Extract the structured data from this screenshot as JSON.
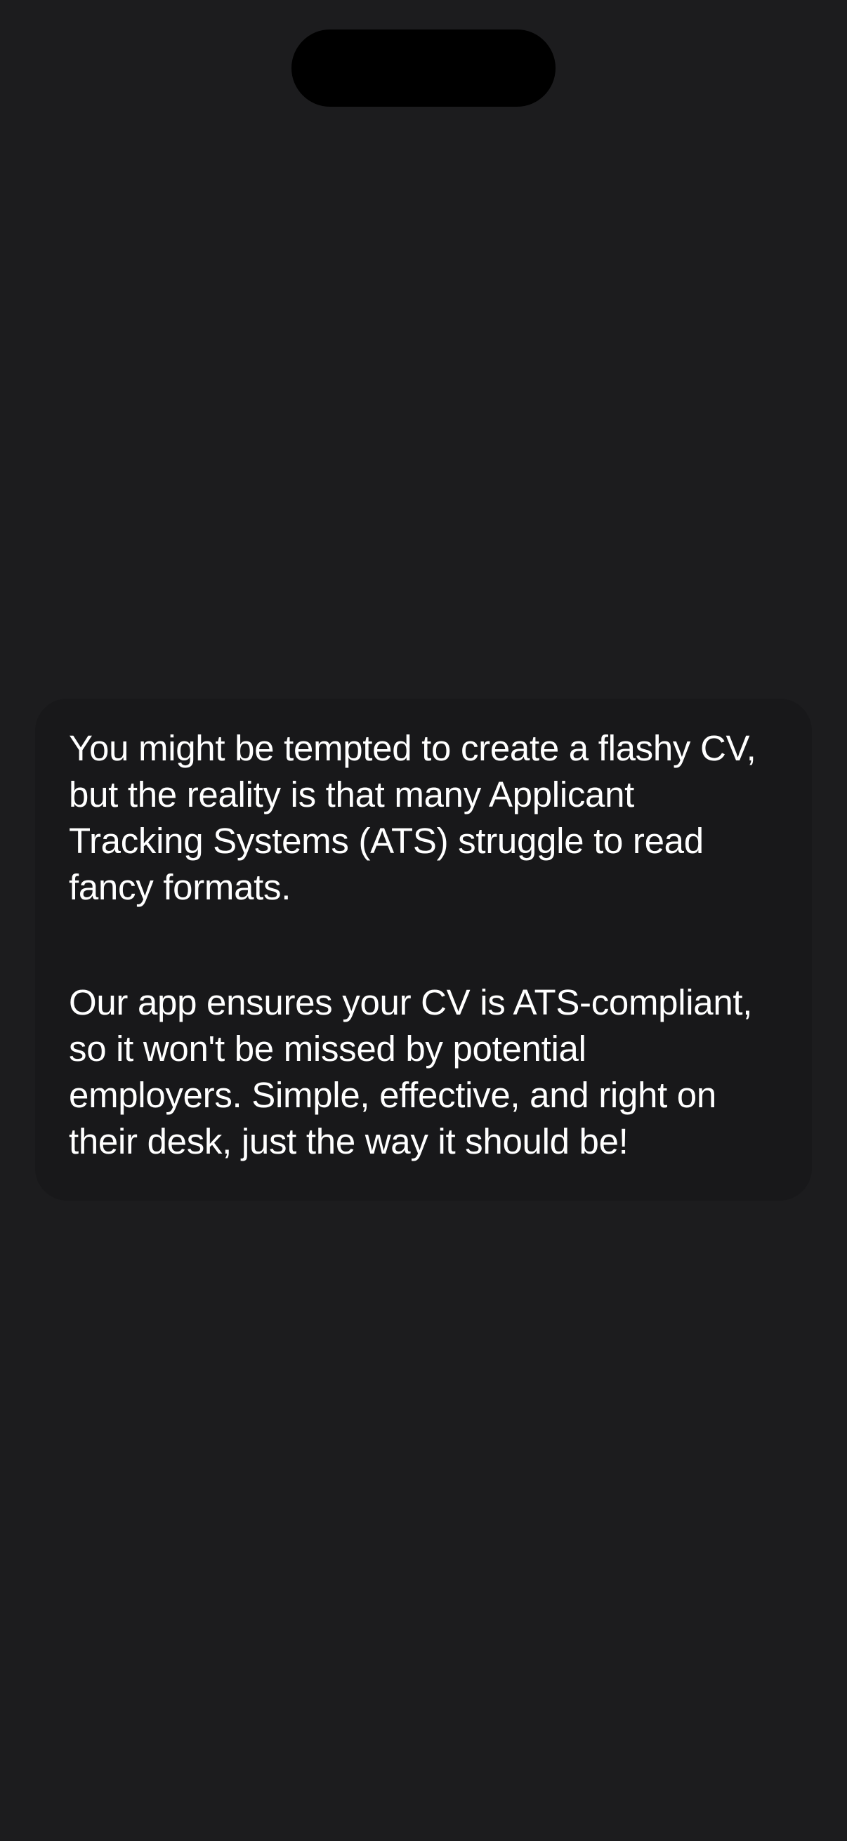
{
  "message": {
    "paragraph_1": {
      "line_1": "You might be tempted to create a flashy CV,",
      "line_2": "but the reality is that many Applicant",
      "line_3": "Tracking Systems (ATS) struggle to read",
      "line_4": "fancy formats."
    },
    "paragraph_2": {
      "line_1": "Our app ensures your CV is ATS-compliant,",
      "line_2": "so it won't be missed by potential",
      "line_3": "employers. Simple, effective, and right on",
      "line_4": "their desk, just the way it should be!"
    }
  }
}
